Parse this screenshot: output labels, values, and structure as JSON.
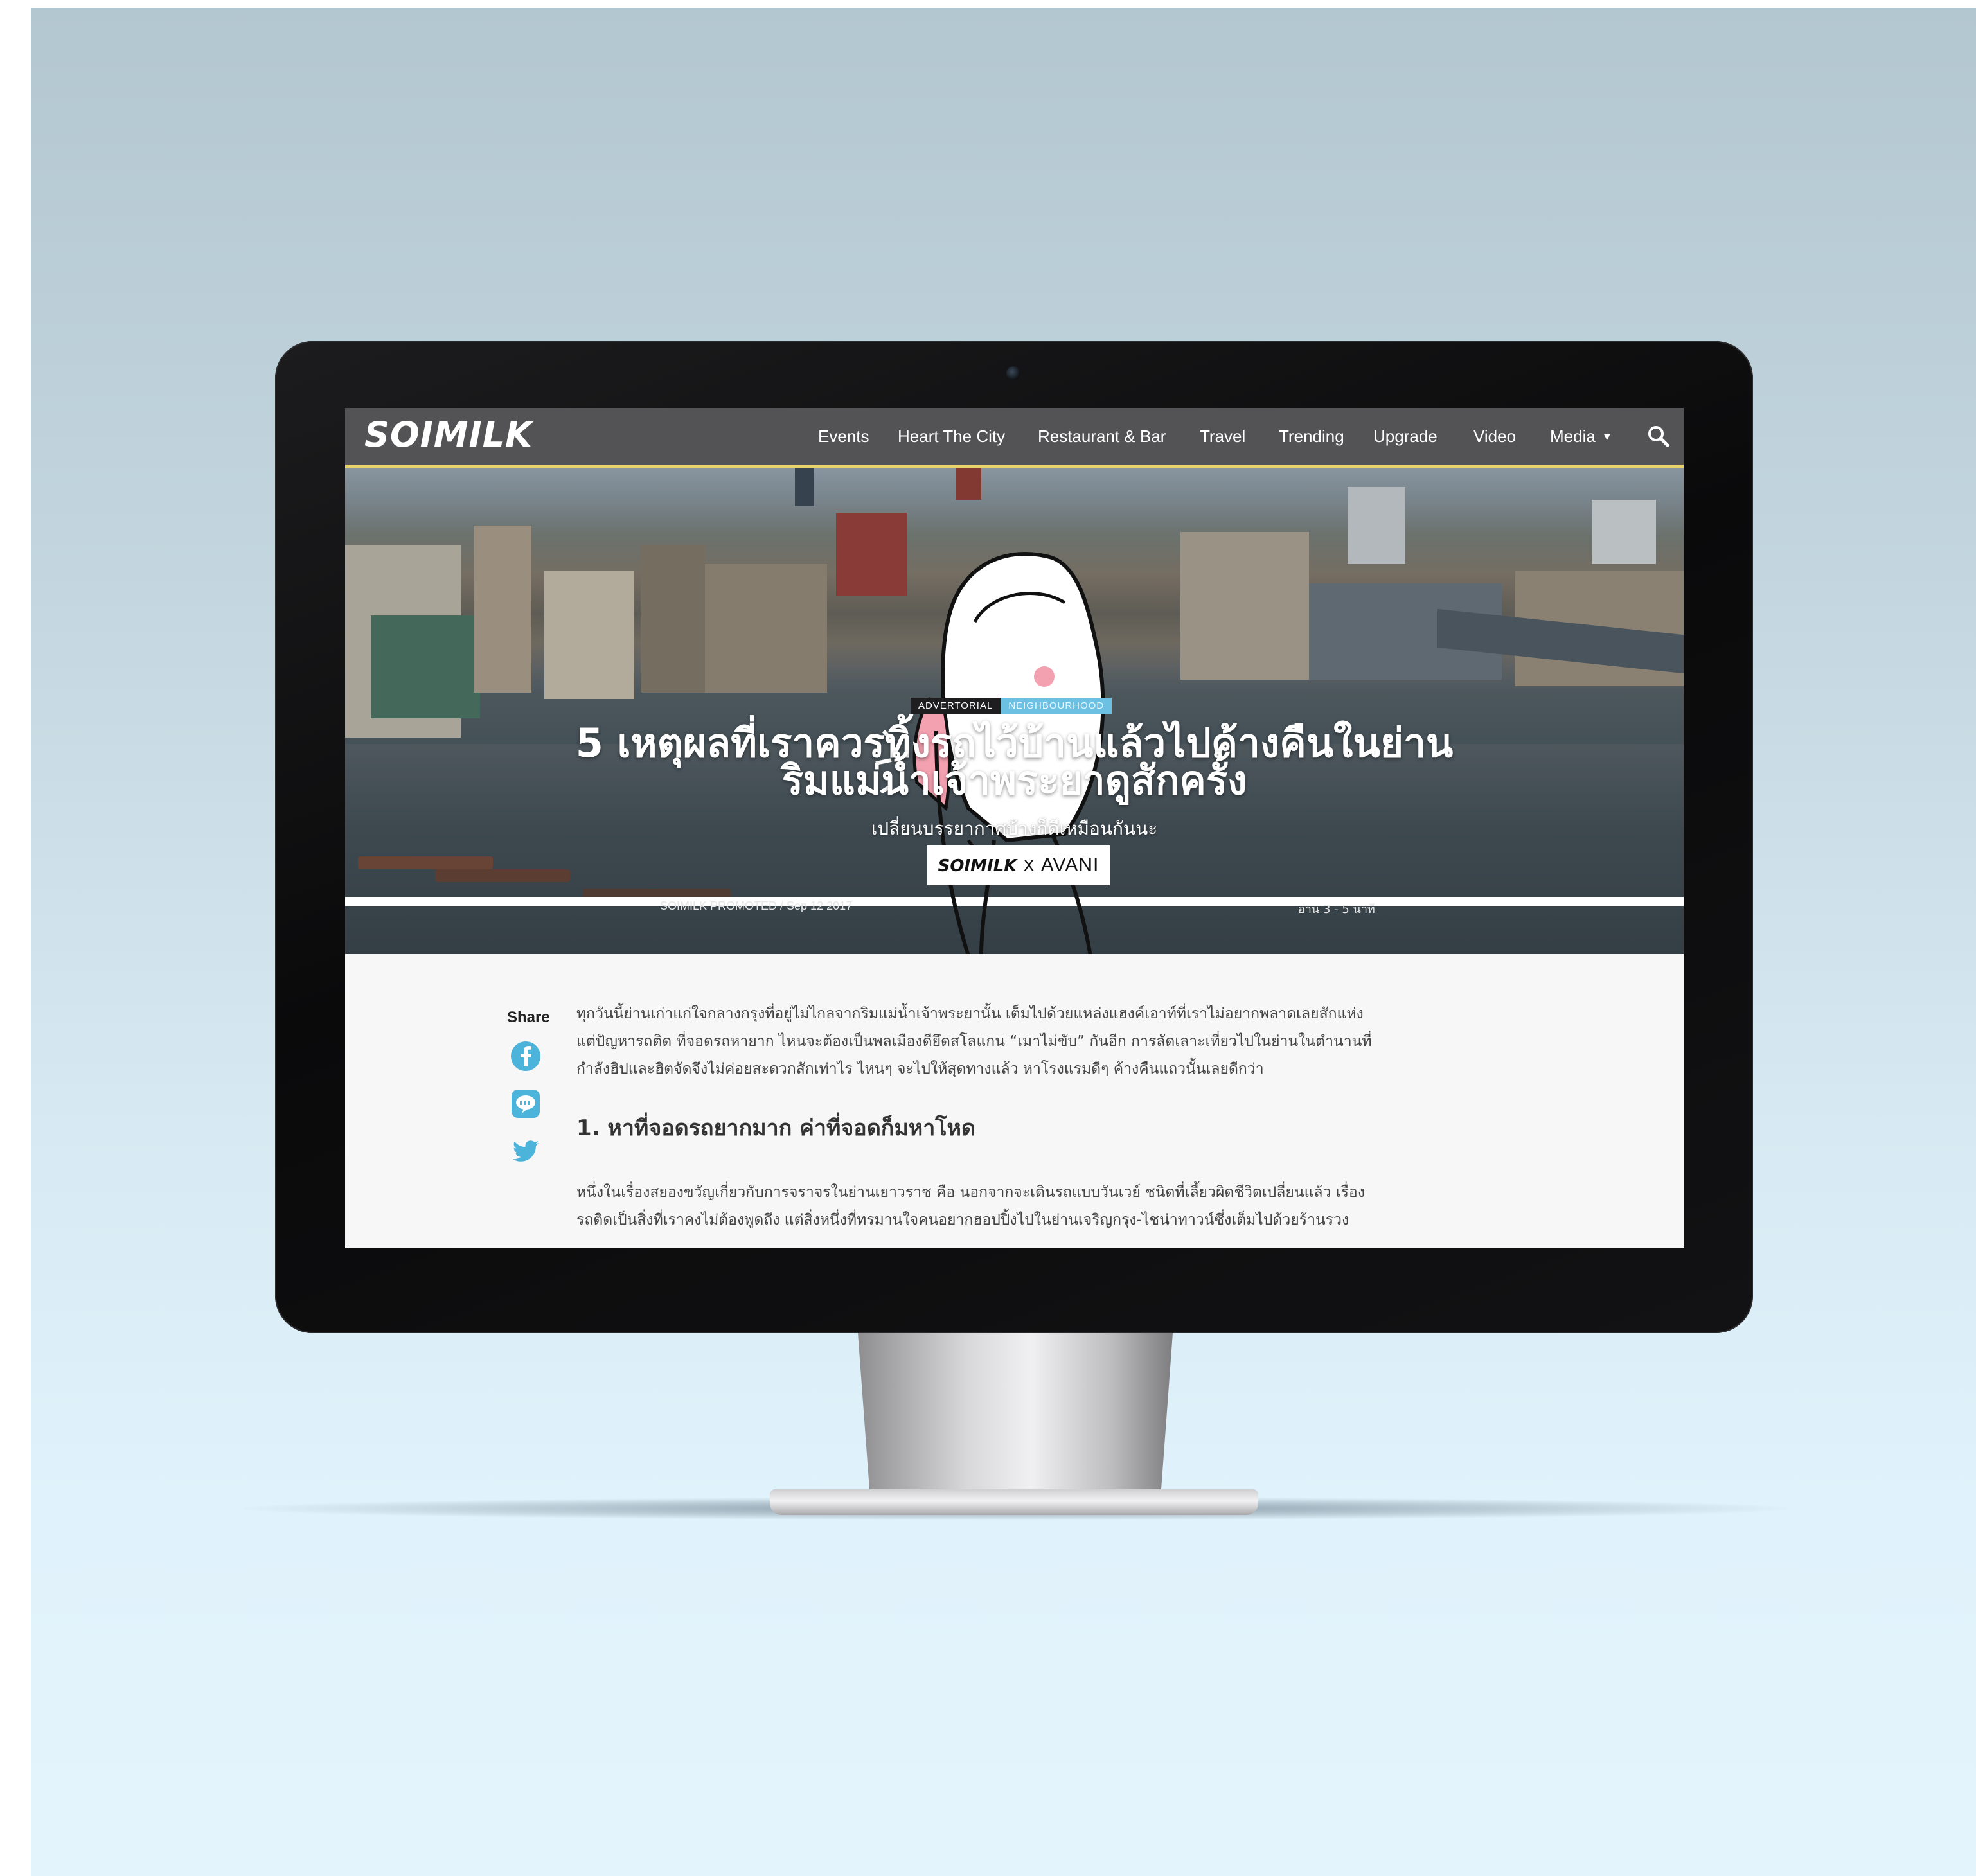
{
  "nav": {
    "logo": "SOIMILK",
    "items": [
      "Events",
      "Heart The City",
      "Restaurant & Bar",
      "Travel",
      "Trending",
      "Upgrade",
      "Video",
      "Media"
    ]
  },
  "hero": {
    "tags": [
      "ADVERTORIAL",
      "NEIGHBOURHOOD"
    ],
    "title_line1": "5 เหตุผลที่เราควรทิ้งรถไว้บ้านแล้วไปค้างคืนในย่าน",
    "title_line2": "ริมแม่น้ำเจ้าพระยาดูสักครั้ง",
    "subtitle": "เปลี่ยนบรรยากาศบ้างก็ดีเหมือนกันนะ",
    "partner": {
      "left": "SOIMILK",
      "x": "X",
      "right": "AVANI"
    },
    "byline": "SOIMILK PROMOTED / Sep 12 2017",
    "read_time": "อ่าน 3 - 5 นาที"
  },
  "article": {
    "share_label": "Share",
    "intro": [
      "ทุกวันนี้ย่านเก่าแก่ใจกลางกรุงที่อยู่ไม่ไกลจากริมแม่น้ำเจ้าพระยานั้น เต็มไปด้วยแหล่งแฮงค์เอาท์ที่เราไม่อยากพลาดเลยสักแห่ง",
      "แต่ปัญหารถติด ที่จอดรถหายาก ไหนจะต้องเป็นพลเมืองดียึดสโลแกน “เมาไม่ขับ” กันอีก การลัดเลาะเที่ยวไปในย่านในตำนานที่",
      "กำลังฮิปและฮิตจัดจึงไม่ค่อยสะดวกสักเท่าไร ไหนๆ จะไปให้สุดทางแล้ว หาโรงแรมดีๆ ค้างคืนแถวนั้นเลยดีกว่า"
    ],
    "heading1": "1. หาที่จอดรถยากมาก ค่าที่จอดก็มหาโหด",
    "para1": [
      "หนึ่งในเรื่องสยองขวัญเกี่ยวกับการจราจรในย่านเยาวราช คือ นอกจากจะเดินรถแบบวันเวย์ ชนิดที่เลี้ยวผิดชีวิตเปลี่ยนแล้ว เรื่อง",
      "รถติดเป็นสิ่งที่เราคงไม่ต้องพูดถึง แต่สิ่งหนึ่งที่ทรมานใจคนอยากฮอปปิ้งไปในย่านเจริญกรุง-ไชน่าทาวน์ซึ่งเต็มไปด้วยร้านรวง"
    ]
  },
  "colors": {
    "nav_accent": "#e7d36c",
    "tag_blue": "#6cc1e2",
    "facebook": "#4cb3db",
    "twitter": "#4cb3db"
  },
  "icons": [
    "search-icon",
    "facebook-icon",
    "line-icon",
    "twitter-icon",
    "webcam-icon",
    "caret-down-icon"
  ]
}
